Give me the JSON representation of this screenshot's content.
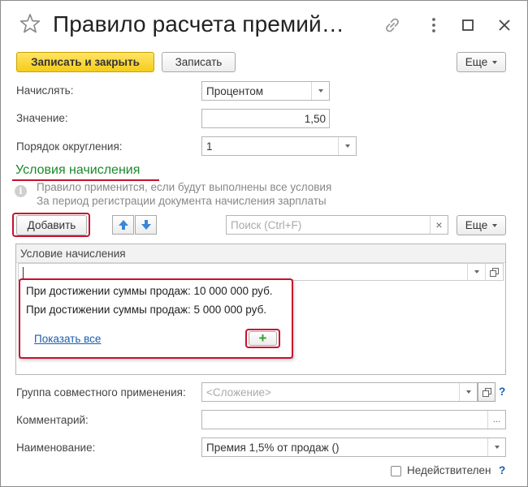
{
  "window": {
    "title": "Правило расчета премий…",
    "icons": [
      "star-icon",
      "link-icon",
      "more-vertical-icon",
      "maximize-icon",
      "close-icon"
    ]
  },
  "toolbar": {
    "save_close_label": "Записать и закрыть",
    "save_label": "Записать",
    "more_label": "Еще"
  },
  "form": {
    "accrue_label": "Начислять:",
    "accrue_value": "Процентом",
    "value_label": "Значение:",
    "value_value": "1,50",
    "rounding_label": "Порядок округления:",
    "rounding_value": "1"
  },
  "conditions": {
    "section_title": "Условия начисления",
    "hint_line1": "Правило применится, если будут выполнены все условия",
    "hint_line2": "За период регистрации документа начисления зарплаты",
    "add_label": "Добавить",
    "search_placeholder": "Поиск (Ctrl+F)",
    "search_clear": "×",
    "more_label": "Еще",
    "column_header": "Условие начисления",
    "input_value": "",
    "dropdown_items": [
      "При достижении суммы продаж: 10 000 000 руб.",
      "При достижении суммы продаж: 5 000 000 руб."
    ],
    "show_all_label": "Показать все",
    "add_plus": "+"
  },
  "bottom": {
    "group_label": "Группа совместного применения:",
    "group_placeholder": "<Сложение>",
    "comment_label": "Комментарий:",
    "comment_value": "",
    "comment_ellipsis": "...",
    "name_label": "Наименование:",
    "name_value": "Премия 1,5% от продаж ()",
    "invalid_label": "Недействителен",
    "help": "?"
  },
  "colors": {
    "primary_button": "#f5cd19",
    "section_title": "#1a8a2a",
    "highlight": "#c8102e",
    "link": "#1a5dad",
    "add_plus": "#2ea42e",
    "arrow": "#3a86d8"
  }
}
